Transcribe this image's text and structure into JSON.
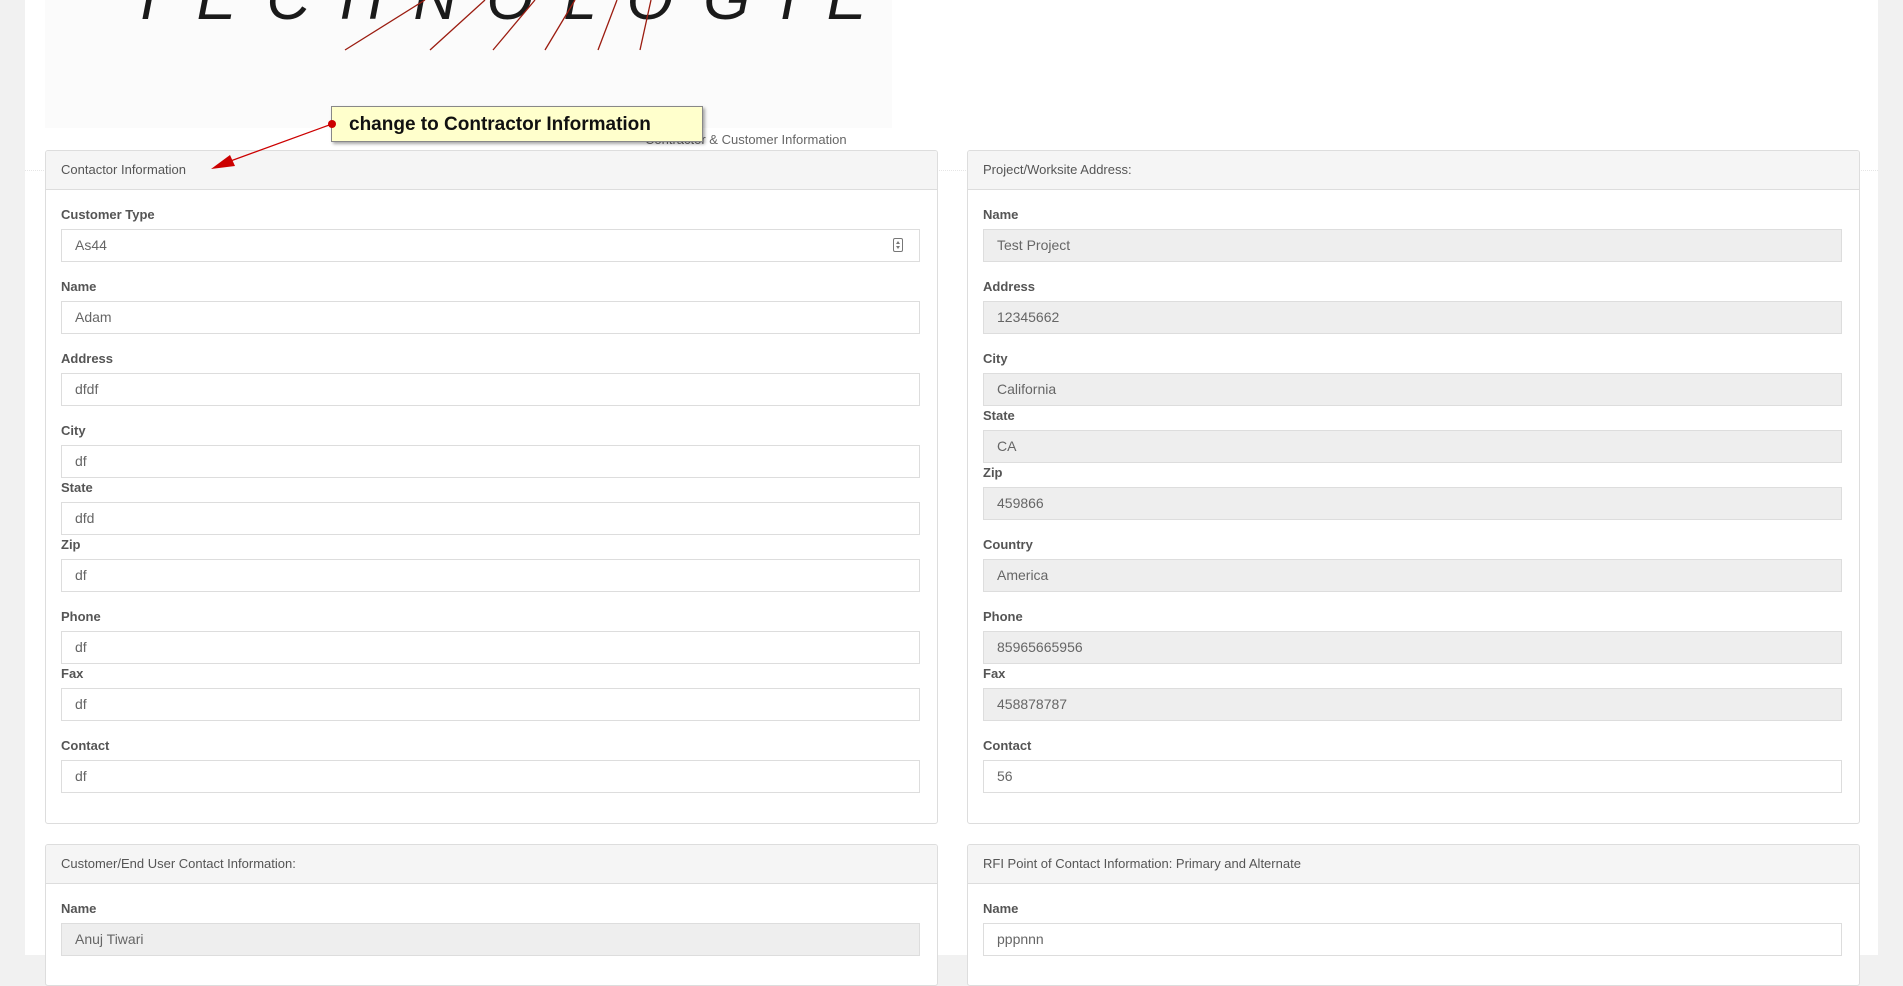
{
  "logo": {
    "text": "TECHNOLOGIES"
  },
  "section_title": "Contractor & Customer Information",
  "annotation": {
    "text": "change to Contractor Information"
  },
  "contractor_panel": {
    "heading": "Contactor Information",
    "fields": {
      "customer_type": {
        "label": "Customer Type",
        "value": "As44"
      },
      "name": {
        "label": "Name",
        "value": "Adam"
      },
      "address": {
        "label": "Address",
        "value": "dfdf"
      },
      "city": {
        "label": "City",
        "value": "df"
      },
      "state": {
        "label": "State",
        "value": "dfd"
      },
      "zip": {
        "label": "Zip",
        "value": "df"
      },
      "phone": {
        "label": "Phone",
        "value": "df"
      },
      "fax": {
        "label": "Fax",
        "value": "df"
      },
      "contact": {
        "label": "Contact",
        "value": "df"
      }
    }
  },
  "project_panel": {
    "heading": "Project/Worksite Address:",
    "fields": {
      "name": {
        "label": "Name",
        "value": "Test Project"
      },
      "address": {
        "label": "Address",
        "value": "12345662"
      },
      "city": {
        "label": "City",
        "value": "California"
      },
      "state": {
        "label": "State",
        "value": "CA"
      },
      "zip": {
        "label": "Zip",
        "value": "459866"
      },
      "country": {
        "label": "Country",
        "value": "America"
      },
      "phone": {
        "label": "Phone",
        "value": "85965665956"
      },
      "fax": {
        "label": "Fax",
        "value": "458878787"
      },
      "contact": {
        "label": "Contact",
        "value": "56"
      }
    }
  },
  "customer_panel": {
    "heading": "Customer/End User Contact Information:",
    "fields": {
      "name": {
        "label": "Name",
        "value": "Anuj Tiwari"
      }
    }
  },
  "rfi_panel": {
    "heading": "RFI Point of Contact Information: Primary and Alternate",
    "fields": {
      "name": {
        "label": "Name",
        "value": "pppnnn"
      }
    }
  },
  "colors": {
    "callout_bg": "#ffffcc",
    "arrow": "#cc0000",
    "logo_lines": "#9b1c10",
    "readonly_bg": "#eeeeee"
  }
}
